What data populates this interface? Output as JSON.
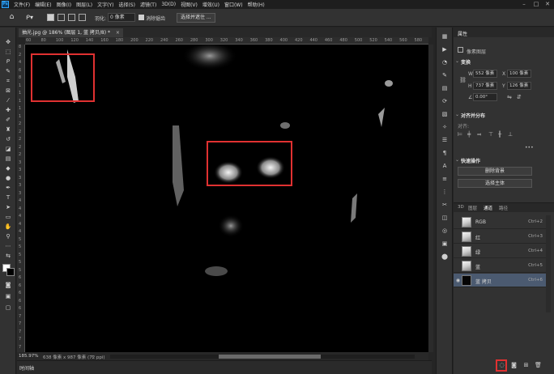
{
  "menubar": {
    "app_logo": "Ps",
    "items": [
      "文件(F)",
      "编辑(E)",
      "图像(I)",
      "图层(L)",
      "文字(Y)",
      "选择(S)",
      "滤镜(T)",
      "3D(D)",
      "视图(V)",
      "增效(U)",
      "窗口(W)",
      "帮助(H)"
    ],
    "window_controls": [
      "–",
      "□",
      "✕"
    ]
  },
  "optionsbar": {
    "feather_label": "羽化:",
    "feather_value": "0 像素",
    "antialias_label": "消除锯齿",
    "select_mask_button": "选择并遮住 ..."
  },
  "document": {
    "tab_title": "抽光.jpg @ 186% (图层 1, 蓝 拷贝/8) *"
  },
  "ruler": {
    "h_ticks": [
      "60",
      "80",
      "100",
      "120",
      "140",
      "160",
      "180",
      "200",
      "220",
      "240",
      "260",
      "280",
      "300",
      "320",
      "340",
      "360",
      "380",
      "400",
      "420",
      "440",
      "460",
      "480",
      "500",
      "520",
      "540",
      "560",
      "580"
    ],
    "v_ticks": [
      "8",
      "2",
      "4",
      "6",
      "8",
      "1",
      "1",
      "1",
      "1",
      "1",
      "2",
      "2",
      "2",
      "2",
      "2",
      "3",
      "3",
      "3",
      "3",
      "3",
      "4",
      "4",
      "4",
      "4",
      "4",
      "5",
      "5",
      "5",
      "5",
      "5",
      "6",
      "6",
      "6",
      "6",
      "6",
      "7",
      "7",
      "7",
      "7",
      "7"
    ]
  },
  "status": {
    "zoom": "185.97%",
    "doc_info": "638 像素 x 987 像素 (72 ppi)"
  },
  "timeline": {
    "label": "时间轴"
  },
  "properties": {
    "tab_title": "属性",
    "layer_kind": "像素图层",
    "transform_title": "变换",
    "w_label": "W",
    "w_value": "552 像素",
    "h_label": "H",
    "h_value": "737 像素",
    "x_label": "X",
    "x_value": "100 像素",
    "y_label": "Y",
    "y_value": "126 像素",
    "angle_value": "0.00°",
    "align_title": "对齐并分布",
    "align_sub": "对齐:",
    "quick_actions_title": "快速操作",
    "remove_bg_button": "删除背景",
    "select_subject_button": "选择主体",
    "more": "•••"
  },
  "channels_panel": {
    "tabs": [
      "3D",
      "图层",
      "通道",
      "路径"
    ],
    "active_tab_index": 2,
    "rows": [
      {
        "name": "RGB",
        "shortcut": "Ctrl+2",
        "visible": false,
        "selected": false
      },
      {
        "name": "红",
        "shortcut": "Ctrl+3",
        "visible": false,
        "selected": false
      },
      {
        "name": "绿",
        "shortcut": "Ctrl+4",
        "visible": false,
        "selected": false
      },
      {
        "name": "蓝",
        "shortcut": "Ctrl+5",
        "visible": false,
        "selected": false
      },
      {
        "name": "蓝 拷贝",
        "shortcut": "Ctrl+6",
        "visible": true,
        "selected": true
      }
    ]
  },
  "colors": {
    "accent": "#31a8ff",
    "highlight_box": "#e03131",
    "selected_row": "#4b5a70"
  }
}
